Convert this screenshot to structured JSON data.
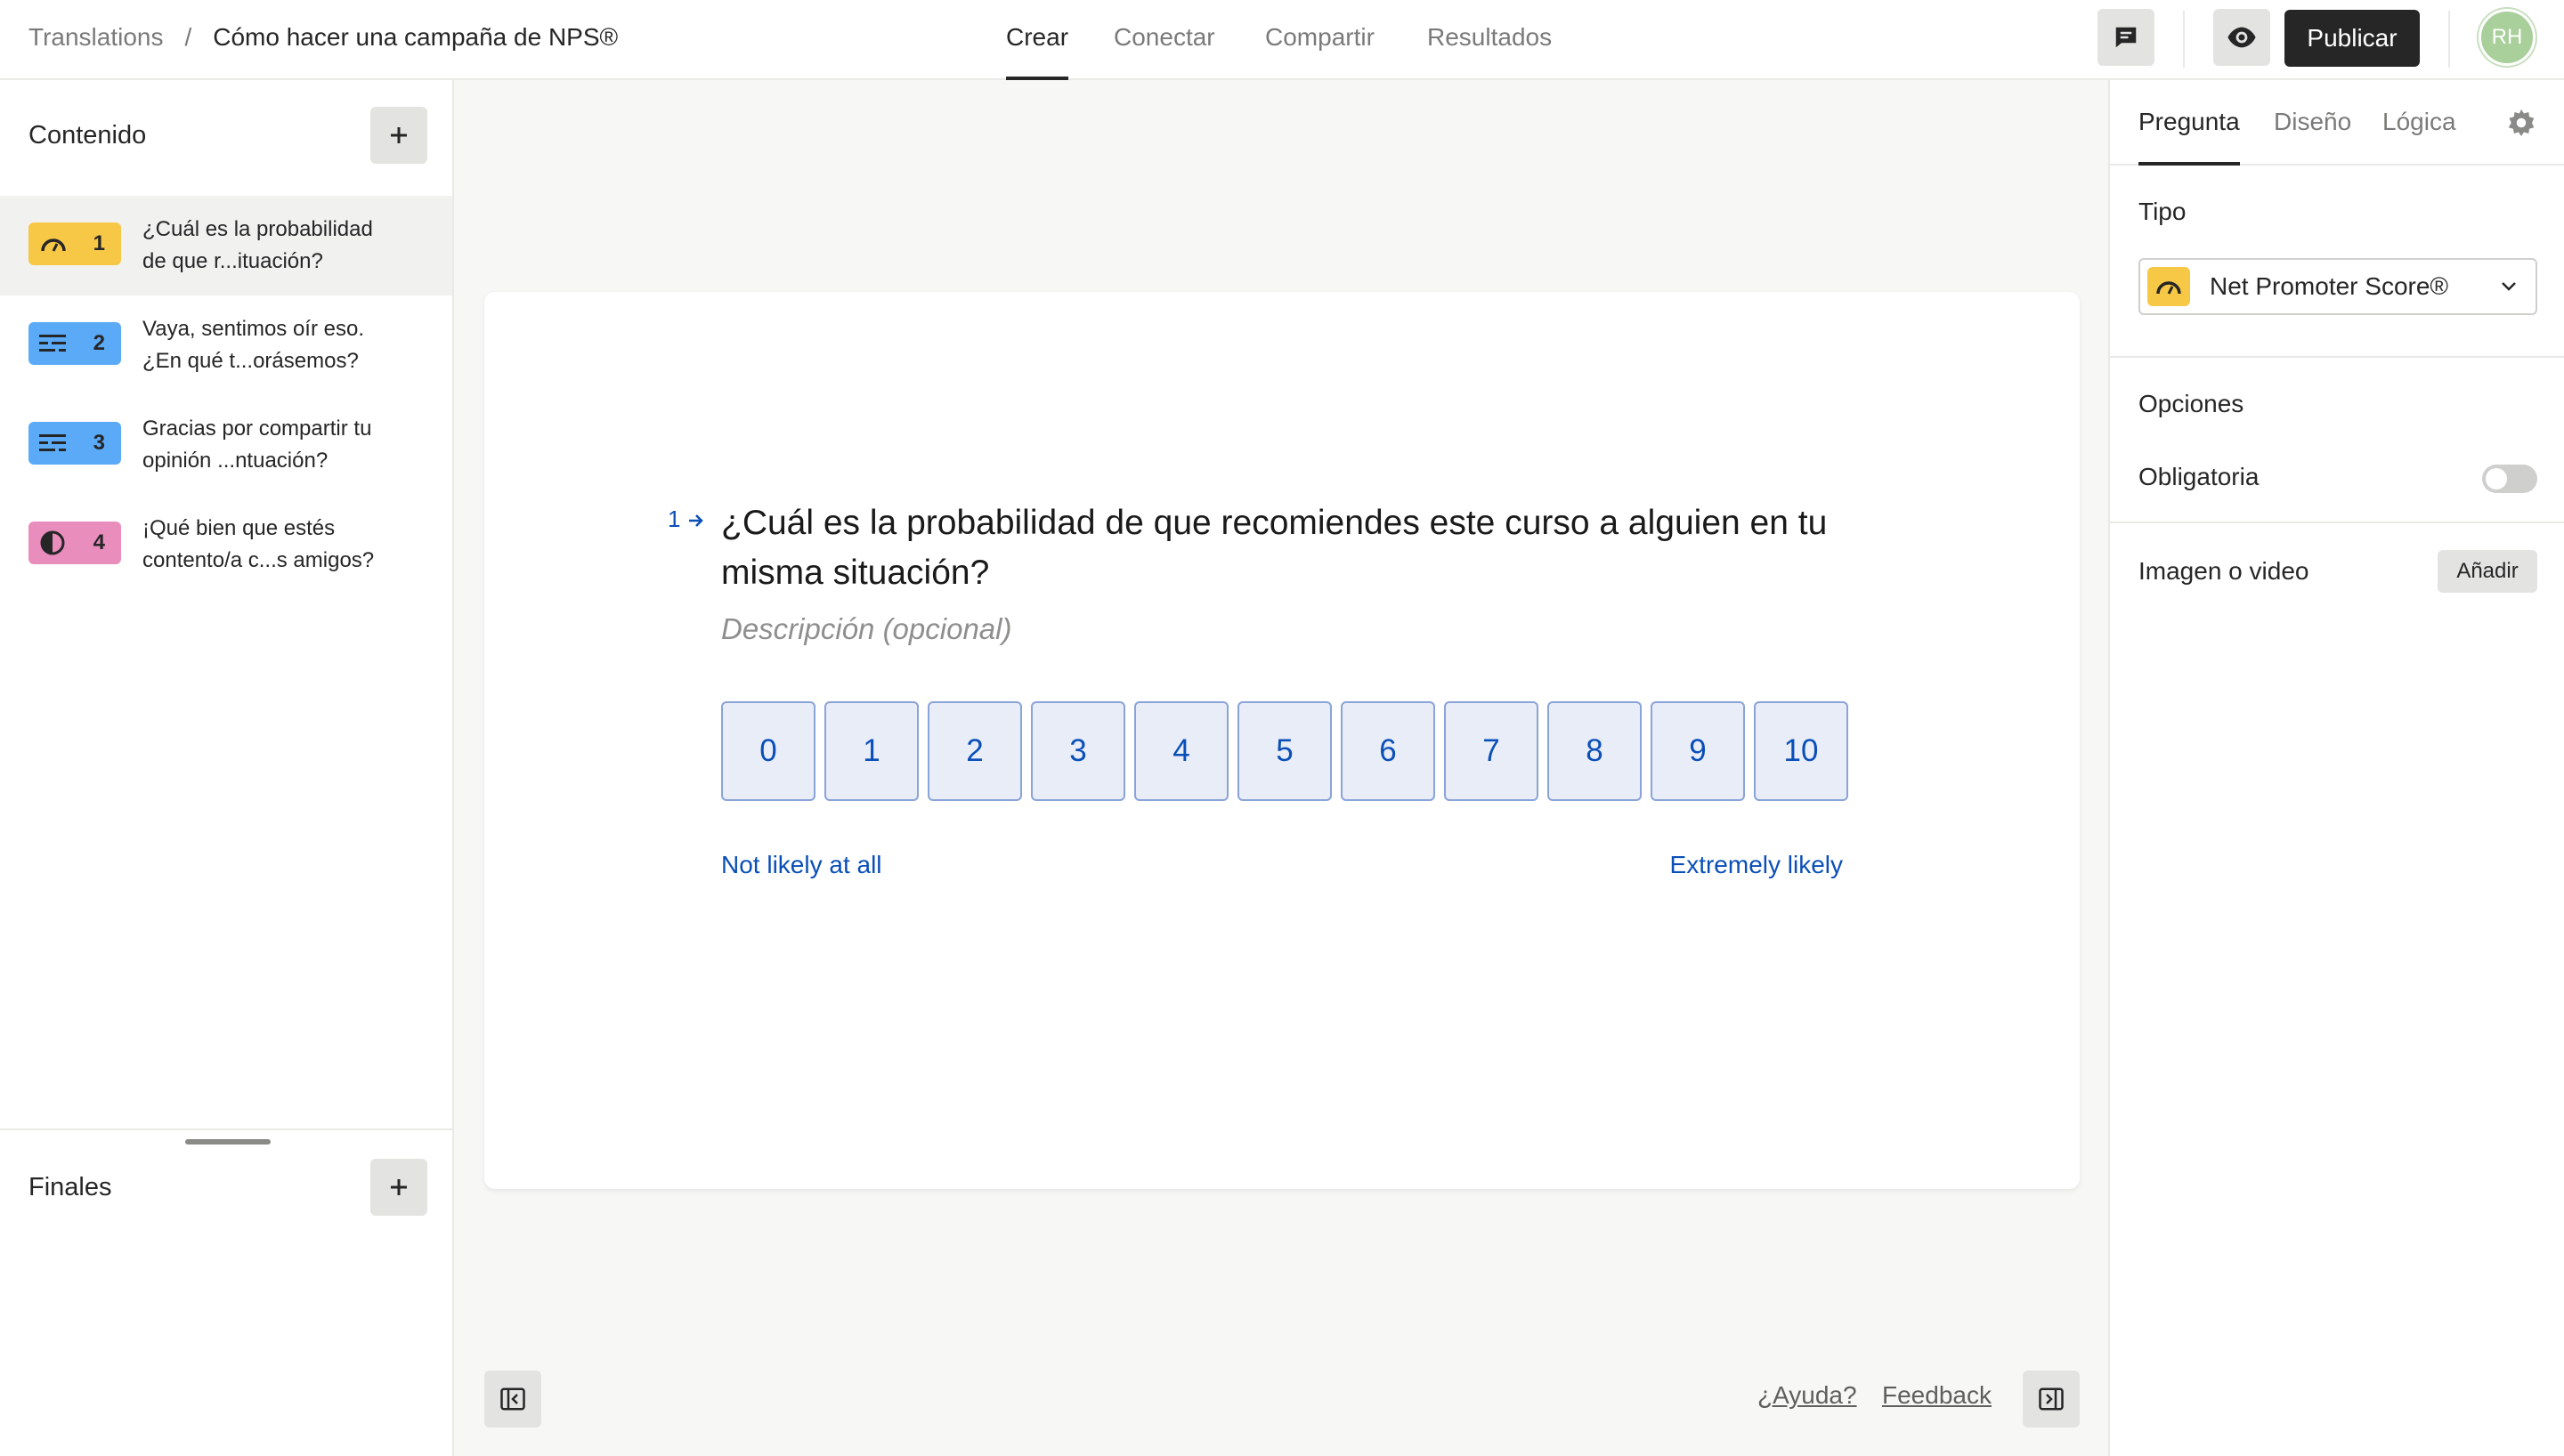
{
  "header": {
    "breadcrumb_root": "Translations",
    "breadcrumb_separator": "/",
    "form_title": "Cómo hacer una campaña de NPS®",
    "tabs": [
      {
        "label": "Crear",
        "active": true
      },
      {
        "label": "Conectar",
        "active": false
      },
      {
        "label": "Compartir",
        "active": false
      },
      {
        "label": "Resultados",
        "active": false
      }
    ],
    "publish_label": "Publicar",
    "avatar_initials": "RH"
  },
  "sidebar": {
    "content_title": "Contenido",
    "questions": [
      {
        "number": "1",
        "line1": "¿Cuál es la probabilidad",
        "line2": "de que r...ituación?",
        "icon": "nps-gauge-icon",
        "color": "#f7c845",
        "active": true
      },
      {
        "number": "2",
        "line1": "Vaya, sentimos oír eso.",
        "line2": "¿En qué t...orásemos?",
        "icon": "long-text-icon",
        "color": "#5aaaf7",
        "active": false
      },
      {
        "number": "3",
        "line1": "Gracias por compartir tu",
        "line2": "opinión ...ntuación?",
        "icon": "long-text-icon",
        "color": "#5aaaf7",
        "active": false
      },
      {
        "number": "4",
        "line1": "¡Qué bien que estés",
        "line2": "contento/a c...s amigos?",
        "icon": "statement-icon",
        "color": "#e98dbd",
        "active": false
      }
    ],
    "endings_title": "Finales"
  },
  "canvas": {
    "question_number": "1",
    "question_title": "¿Cuál es la probabilidad de que recomiendes este curso a alguien en tu misma situación?",
    "description_placeholder": "Descripción (opcional)",
    "scale": [
      "0",
      "1",
      "2",
      "3",
      "4",
      "5",
      "6",
      "7",
      "8",
      "9",
      "10"
    ],
    "label_left": "Not likely at all",
    "label_right": "Extremely likely"
  },
  "footer": {
    "help_label": "¿Ayuda?",
    "feedback_label": "Feedback"
  },
  "right_panel": {
    "tabs": [
      {
        "label": "Pregunta",
        "active": true
      },
      {
        "label": "Diseño",
        "active": false
      },
      {
        "label": "Lógica",
        "active": false
      }
    ],
    "type_label": "Tipo",
    "type_value": "Net Promoter Score®",
    "options_label": "Opciones",
    "required_label": "Obligatoria",
    "required_on": false,
    "media_label": "Imagen o video",
    "add_media_label": "Añadir"
  },
  "colors": {
    "accent_blue": "#0a4fb8",
    "nps_yellow": "#f7c845",
    "text_blue": "#5aaaf7",
    "statement_pink": "#e98dbd",
    "publish_dark": "#262627"
  }
}
